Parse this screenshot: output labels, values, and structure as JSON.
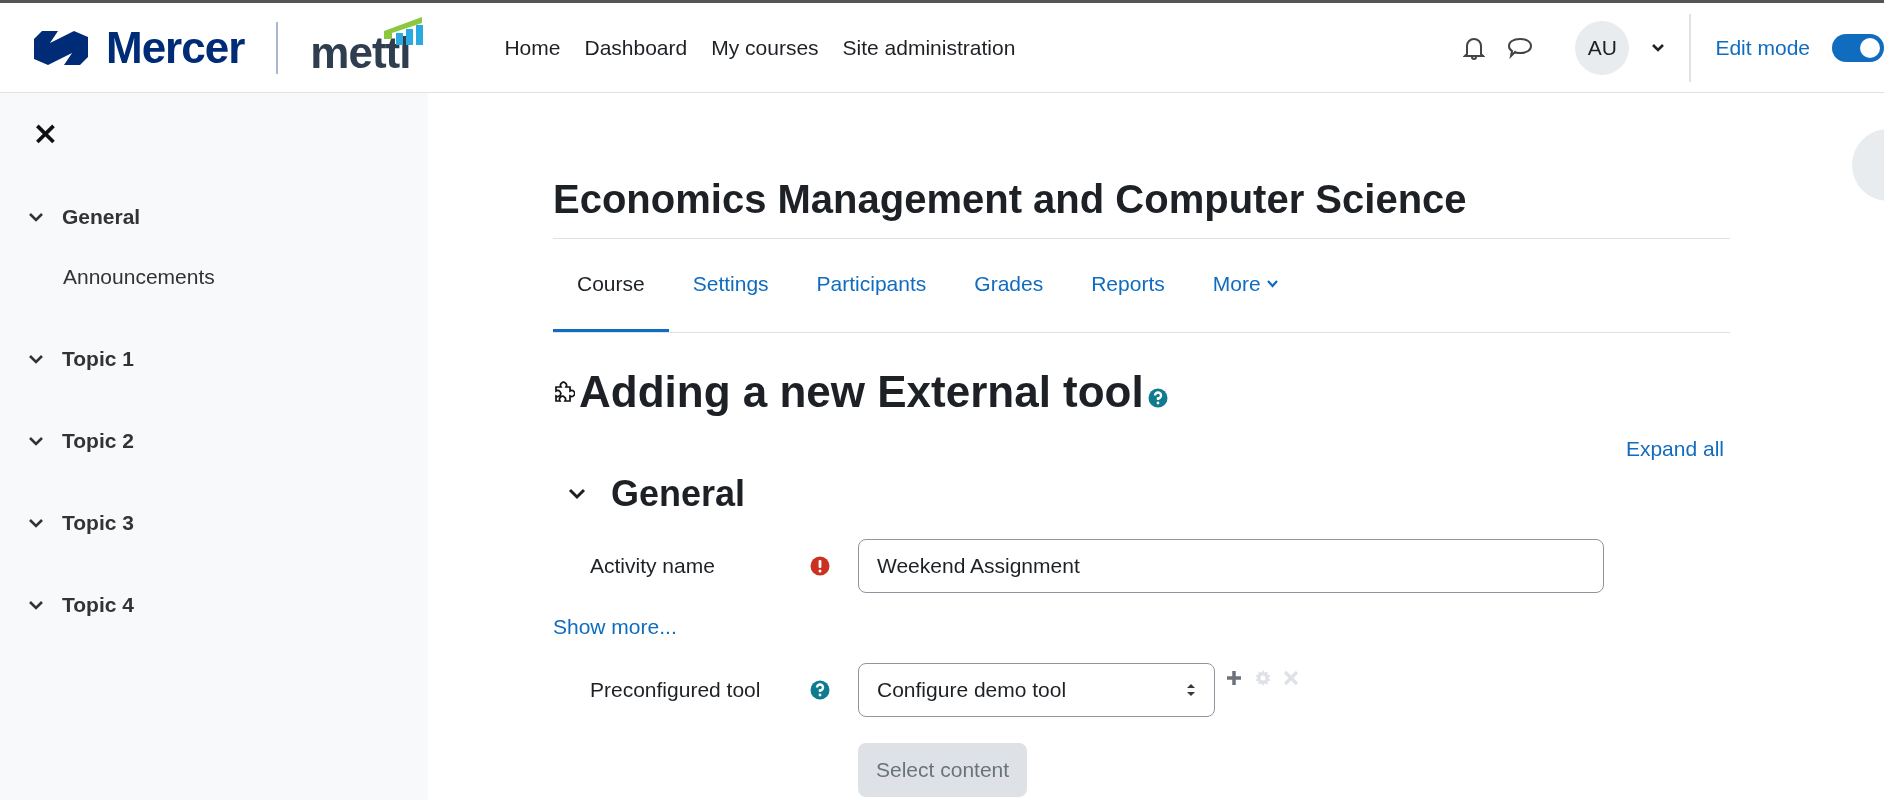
{
  "header": {
    "brand": "Mercer",
    "product": "mettl",
    "nav": [
      {
        "label": "Home"
      },
      {
        "label": "Dashboard"
      },
      {
        "label": "My courses"
      },
      {
        "label": "Site administration"
      }
    ],
    "user_initials": "AU",
    "edit_mode": {
      "label": "Edit mode",
      "on": true
    }
  },
  "sidebar": {
    "close": "×",
    "sections": [
      {
        "title": "General",
        "expanded": true,
        "children": [
          {
            "label": "Announcements"
          }
        ]
      },
      {
        "title": "Topic 1",
        "expanded": true
      },
      {
        "title": "Topic 2",
        "expanded": true
      },
      {
        "title": "Topic 3",
        "expanded": true
      },
      {
        "title": "Topic 4",
        "expanded": true
      }
    ]
  },
  "course_title": "Economics Management and Computer Science",
  "tabs": [
    {
      "label": "Course",
      "selected": true,
      "kind": "link"
    },
    {
      "label": "Settings",
      "selected": false,
      "kind": "link"
    },
    {
      "label": "Participants",
      "selected": false,
      "kind": "link"
    },
    {
      "label": "Grades",
      "selected": false,
      "kind": "link"
    },
    {
      "label": "Reports",
      "selected": false,
      "kind": "link"
    },
    {
      "label": "More",
      "selected": false,
      "kind": "menu"
    }
  ],
  "page_heading": "Adding a new External tool",
  "expand_all": "Expand all",
  "section": {
    "title": "General",
    "expanded": true
  },
  "fields": [
    {
      "label": "Activity name",
      "required": true,
      "kind": "text",
      "value": "Weekend Assignment"
    },
    {
      "kind": "link",
      "label": "Show more..."
    },
    {
      "label": "Preconfigured tool",
      "help": true,
      "kind": "select",
      "value": "Configure demo tool",
      "actions": [
        {
          "kind": "add",
          "disabled": false
        },
        {
          "kind": "configure",
          "disabled": true
        },
        {
          "kind": "remove",
          "disabled": true
        }
      ]
    }
  ],
  "select_button": {
    "label": "Select content",
    "disabled": true
  }
}
